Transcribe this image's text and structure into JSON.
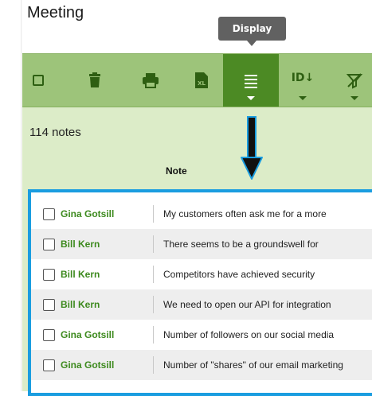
{
  "title": "Meeting",
  "tooltip": "Display",
  "toolbar": {
    "buttons": [
      {
        "name": "select-all-checkbox",
        "icon": "checkbox-icon"
      },
      {
        "name": "delete-button",
        "icon": "trash-icon"
      },
      {
        "name": "print-button",
        "icon": "printer-icon"
      },
      {
        "name": "export-excel-button",
        "icon": "excel-icon",
        "icon_text": "XL"
      },
      {
        "name": "display-button",
        "icon": "list-icon",
        "active": true
      },
      {
        "name": "sort-button",
        "icon": "sort-id-icon",
        "label": "ID↓"
      },
      {
        "name": "filter-button",
        "icon": "filter-off-icon"
      }
    ]
  },
  "notes_count": "114 notes",
  "column_header": "Note",
  "rows": [
    {
      "author": "Gina Gotsill",
      "note": "My customers often ask me for a more"
    },
    {
      "author": "Bill Kern",
      "note": "There seems to be a groundswell for"
    },
    {
      "author": "Bill Kern",
      "note": "Competitors have achieved security"
    },
    {
      "author": "Bill Kern",
      "note": "We need to open our API for integration"
    },
    {
      "author": "Gina Gotsill",
      "note": "Number of followers on our social media"
    },
    {
      "author": "Gina Gotsill",
      "note": "Number of \"shares\" of our email marketing"
    }
  ],
  "colors": {
    "toolbar": "#9dc47a",
    "toolbar_active": "#4c8a24",
    "panel": "#dcecc8",
    "highlight_border": "#1a9de0",
    "author_text": "#3d8a1e"
  }
}
